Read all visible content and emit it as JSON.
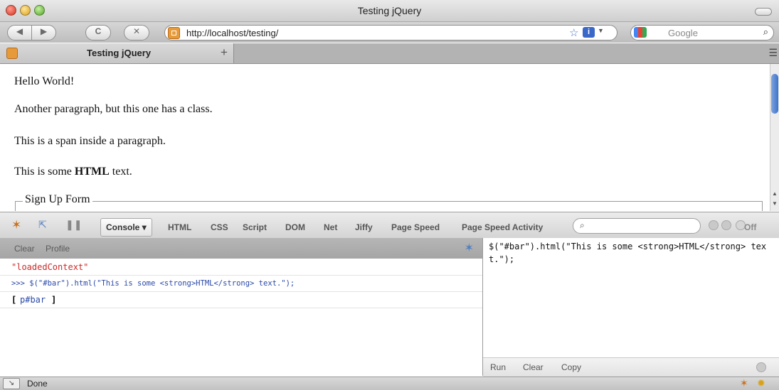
{
  "window": {
    "title": "Testing jQuery"
  },
  "toolbar": {
    "url": "http://localhost/testing/",
    "search_placeholder": "Google",
    "back_glyph": "◀",
    "forward_glyph": "▶",
    "reload_glyph": "C",
    "stop_glyph": "✕",
    "info_badge": "i"
  },
  "tabs": [
    {
      "label": "Testing jQuery"
    }
  ],
  "new_tab_glyph": "+",
  "page": {
    "paragraphs": [
      "Hello World!",
      "Another paragraph, but this one has a class.",
      "This is a span inside a paragraph."
    ],
    "html_line": {
      "before": "This is some ",
      "bold": "HTML",
      "after": " text."
    },
    "fieldset_legend": "Sign Up Form"
  },
  "firebug": {
    "tabs": [
      "Console",
      "HTML",
      "CSS",
      "Script",
      "DOM",
      "Net",
      "Jiffy",
      "Page Speed",
      "Page Speed Activity"
    ],
    "console_caret": "▾",
    "off_label": "Off",
    "console_buttons": [
      "Clear",
      "Profile"
    ],
    "log": {
      "context": "\"loadedContext\"",
      "command": ">>> $(\"#bar\").html(\"This is some <strong>HTML</strong> text.\");",
      "result_open": "[",
      "result_element": "p#bar",
      "result_close": "]"
    },
    "editor_text": "$(\"#bar\").html(\"This is some <strong>HTML</strong> text.\");",
    "editor_buttons": [
      "Run",
      "Clear",
      "Copy"
    ]
  },
  "status": {
    "text": "Done"
  },
  "colors": {
    "accent": "#3f72c9",
    "error_red": "#cc2a2a",
    "command_blue": "#2a49a8"
  }
}
